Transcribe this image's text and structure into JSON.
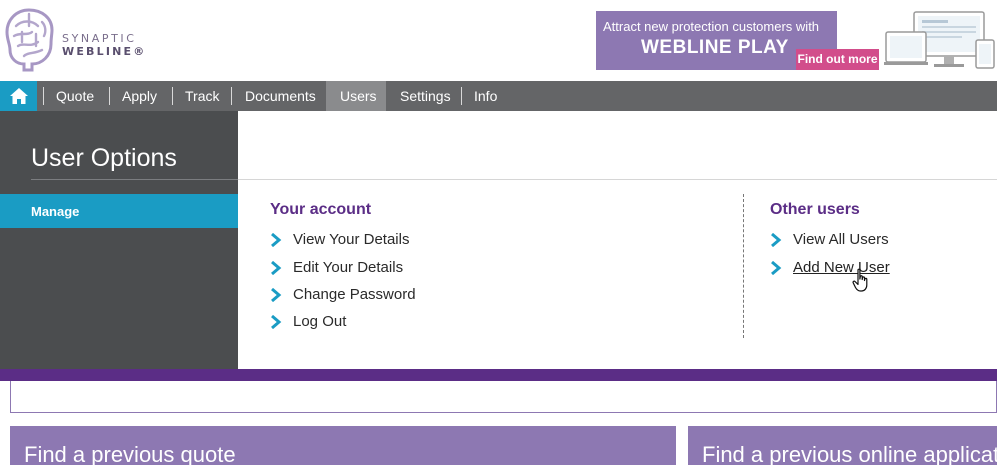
{
  "brand": {
    "line1": "SYNAPTIC",
    "line2": "WEBLINE®",
    "logo_icon": "brain-icon",
    "colors": {
      "purple": "#8d78b2",
      "deep_purple": "#5b2d86",
      "teal": "#1a9cc4",
      "pink": "#d24d8b"
    }
  },
  "ad": {
    "line1": "Attract new protection customers with",
    "line2": "WEBLINE PLAY",
    "button": "Find out more",
    "image_icon": "devices-icon"
  },
  "nav": {
    "home_icon": "home-icon",
    "items": [
      {
        "label": "Quote"
      },
      {
        "label": "Apply"
      },
      {
        "label": "Track"
      },
      {
        "label": "Documents"
      },
      {
        "label": "Users",
        "active": true
      },
      {
        "label": "Settings"
      },
      {
        "label": "Info"
      }
    ]
  },
  "dropdown": {
    "title": "User Options",
    "side_item": "Manage",
    "your_account": {
      "heading": "Your account",
      "links": [
        "View Your Details",
        "Edit Your Details",
        "Change Password",
        "Log Out"
      ]
    },
    "other_users": {
      "heading": "Other users",
      "links": [
        "View All Users",
        "Add New User"
      ]
    }
  },
  "cards": [
    {
      "title": "Find a previous quote"
    },
    {
      "title": "Find a previous online application"
    }
  ]
}
